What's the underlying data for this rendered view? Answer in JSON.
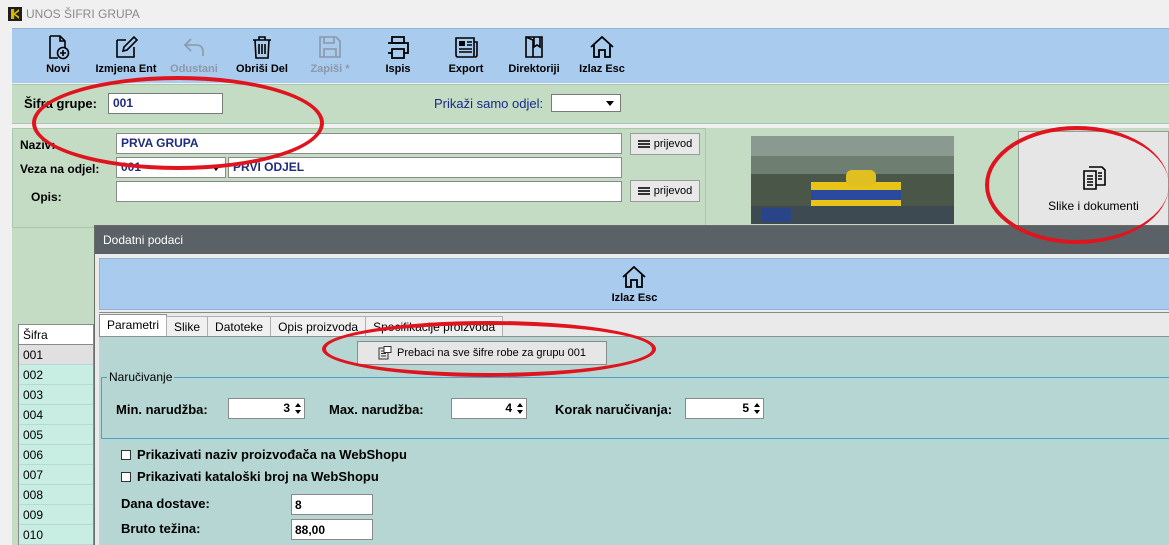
{
  "window": {
    "title": "UNOS ŠIFRI GRUPA"
  },
  "toolbar": {
    "items": [
      {
        "label": "Novi",
        "icon": "new-document-icon",
        "enabled": true
      },
      {
        "label": "Izmjena Ent",
        "icon": "edit-icon",
        "enabled": true
      },
      {
        "label": "Odustani",
        "icon": "undo-icon",
        "enabled": false
      },
      {
        "label": "Obriši Del",
        "icon": "trash-icon",
        "enabled": true
      },
      {
        "label": "Zapiši *",
        "icon": "save-icon",
        "enabled": false
      },
      {
        "label": "Ispis",
        "icon": "printer-icon",
        "enabled": true
      },
      {
        "label": "Export",
        "icon": "export-icon",
        "enabled": true
      },
      {
        "label": "Direktoriji",
        "icon": "directory-icon",
        "enabled": true
      },
      {
        "label": "Izlaz Esc",
        "icon": "home-icon",
        "enabled": true
      }
    ]
  },
  "filter": {
    "sifra_label": "Šifra grupe:",
    "sifra_value": "001",
    "odjel_label": "Prikaži samo odjel:",
    "odjel_value": ""
  },
  "form": {
    "naziv_label": "Naziv:",
    "naziv_value": "PRVA GRUPA",
    "veza_label": "Veza na odjel:",
    "veza_code": "001",
    "veza_name": "PRVI ODJEL",
    "opis_label": "Opis:",
    "opis_value": "",
    "prijevod_label": "prijevod"
  },
  "docs_button": {
    "label": "Slike i dokumenti",
    "icon": "documents-icon"
  },
  "grid": {
    "header": "Šifra",
    "rows": [
      "001",
      "002",
      "003",
      "004",
      "005",
      "006",
      "007",
      "008",
      "009",
      "010"
    ]
  },
  "dialog": {
    "title": "Dodatni podaci",
    "exit_label": "Izlaz Esc",
    "tabs": [
      "Parametri",
      "Slike",
      "Datoteke",
      "Opis proizvoda",
      "Specifikacije proizvoda"
    ],
    "active_tab": 0,
    "prebaci_label": "Prebaci na sve šifre robe za grupu 001",
    "narucivanje": {
      "legend": "Naručivanje",
      "min_label": "Min. narudžba:",
      "min_value": "3",
      "max_label": "Max. narudžba:",
      "max_value": "4",
      "korak_label": "Korak naručivanja:",
      "korak_value": "5"
    },
    "chk_proizvodjac": "Prikazivati naziv proizvođača na WebShopu",
    "chk_katalog": "Prikazivati kataloški broj na WebShopu",
    "dana_label": "Dana dostave:",
    "dana_value": "8",
    "bruto_label": "Bruto težina:",
    "bruto_value": "88,00"
  },
  "colors": {
    "toolbar_bg": "#a9cbee",
    "form_bg": "#c4dcc4",
    "panel_bg": "#b5d6d2",
    "annotation": "#e0141e"
  }
}
